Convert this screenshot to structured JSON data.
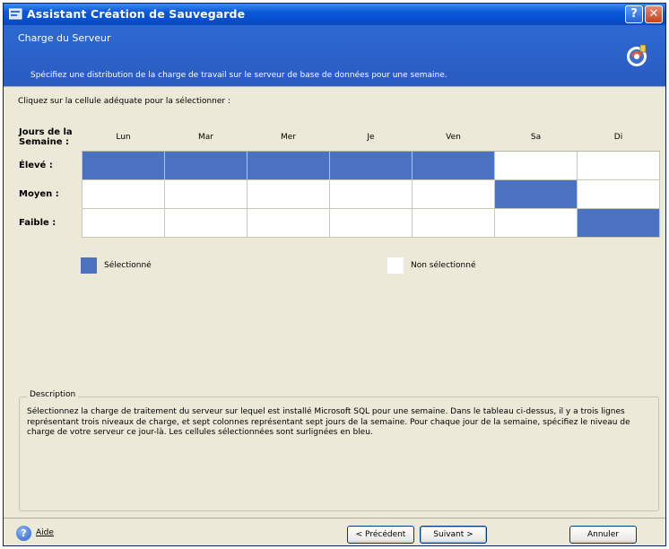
{
  "window": {
    "title": "Assistant Création de Sauvegarde",
    "help_glyph": "?",
    "close_glyph": "✕"
  },
  "header": {
    "title": "Charge du Serveur",
    "description": "Spécifiez une distribution de la charge de travail sur le serveur de base de données pour une semaine."
  },
  "instruction": "Cliquez sur la cellule adéquate pour la sélectionner :",
  "grid": {
    "corner_label": "Jours de la Semaine :",
    "days": [
      "Lun",
      "Mar",
      "Mer",
      "Je",
      "Ven",
      "Sa",
      "Di"
    ],
    "rows": [
      {
        "label": "Élevé :",
        "selected": [
          true,
          true,
          true,
          true,
          true,
          false,
          false
        ]
      },
      {
        "label": "Moyen :",
        "selected": [
          false,
          false,
          false,
          false,
          false,
          true,
          false
        ]
      },
      {
        "label": "Faible :",
        "selected": [
          false,
          false,
          false,
          false,
          false,
          false,
          true
        ]
      }
    ]
  },
  "legend": {
    "selected_label": "Sélectionné",
    "unselected_label": "Non sélectionné",
    "selected_color": "#4a72c0",
    "unselected_color": "#ffffff"
  },
  "description": {
    "legend": "Description",
    "text": "Sélectionnez la charge de traitement du serveur sur lequel est installé Microsoft SQL pour une semaine. Dans le tableau ci-dessus, il y a trois lignes représentant trois niveaux de charge, et sept colonnes représentant sept jours de la semaine. Pour chaque jour de la semaine, spécifiez le niveau de charge de votre serveur ce jour-là. Les cellules sélectionnées sont surlignées en bleu."
  },
  "footer": {
    "help_label": "Aide",
    "help_glyph": "?",
    "previous_label": "< Précédent",
    "next_label": "Suivant >",
    "cancel_label": "Annuler"
  },
  "icons": {
    "title_icon": "app-icon",
    "header_icon": "backup-wizard-icon",
    "help_icon": "help-icon"
  }
}
